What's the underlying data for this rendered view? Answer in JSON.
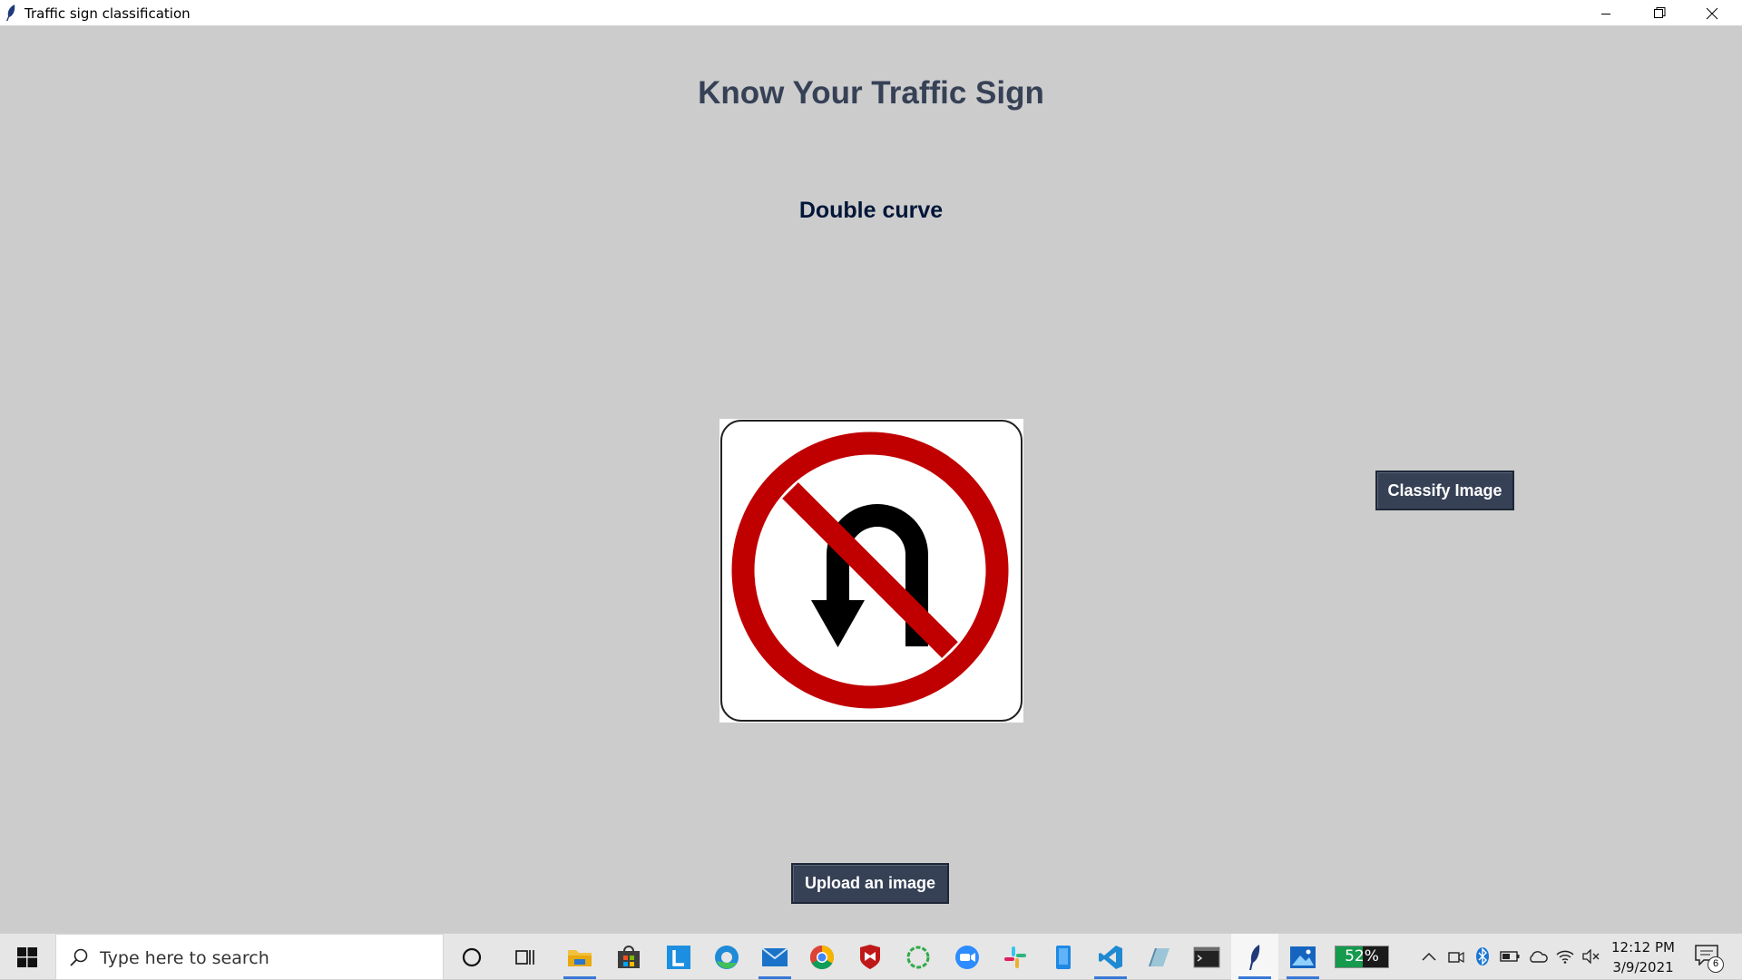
{
  "window": {
    "title": "Traffic sign classification",
    "app_icon": "feather-icon",
    "controls": [
      "minimize",
      "restore",
      "close"
    ]
  },
  "app": {
    "heading": "Know Your Traffic Sign",
    "result_label": "Double curve",
    "image": "no-u-turn-sign",
    "classify_button": "Classify Image",
    "upload_button": "Upload an image",
    "colors": {
      "background": "#cccccc",
      "heading": "#364156",
      "result": "#011638",
      "button_bg": "#364156",
      "button_fg": "#ffffff"
    }
  },
  "taskbar": {
    "search_placeholder": "Type here to search",
    "pinned_icons": [
      "cortana-icon",
      "task-view-icon",
      "file-explorer-icon",
      "store-icon",
      "lexicon-app-icon",
      "edge-icon",
      "mail-icon",
      "chrome-icon",
      "mcafee-icon",
      "refresh-app-icon",
      "zoom-icon",
      "slack-icon",
      "phone-app-icon",
      "vscode-icon",
      "paper-app-icon",
      "terminal-icon",
      "python-feather-icon",
      "photos-icon"
    ],
    "battery_widget": "52%",
    "battery_level": 0.52,
    "tray_icons": [
      "chevron-up-icon",
      "meet-now-icon",
      "bluetooth-icon",
      "battery-icon",
      "onedrive-icon",
      "wifi-icon",
      "volume-muted-icon"
    ],
    "clock": {
      "time": "12:12 PM",
      "date": "3/9/2021"
    },
    "notification_count": "6"
  }
}
